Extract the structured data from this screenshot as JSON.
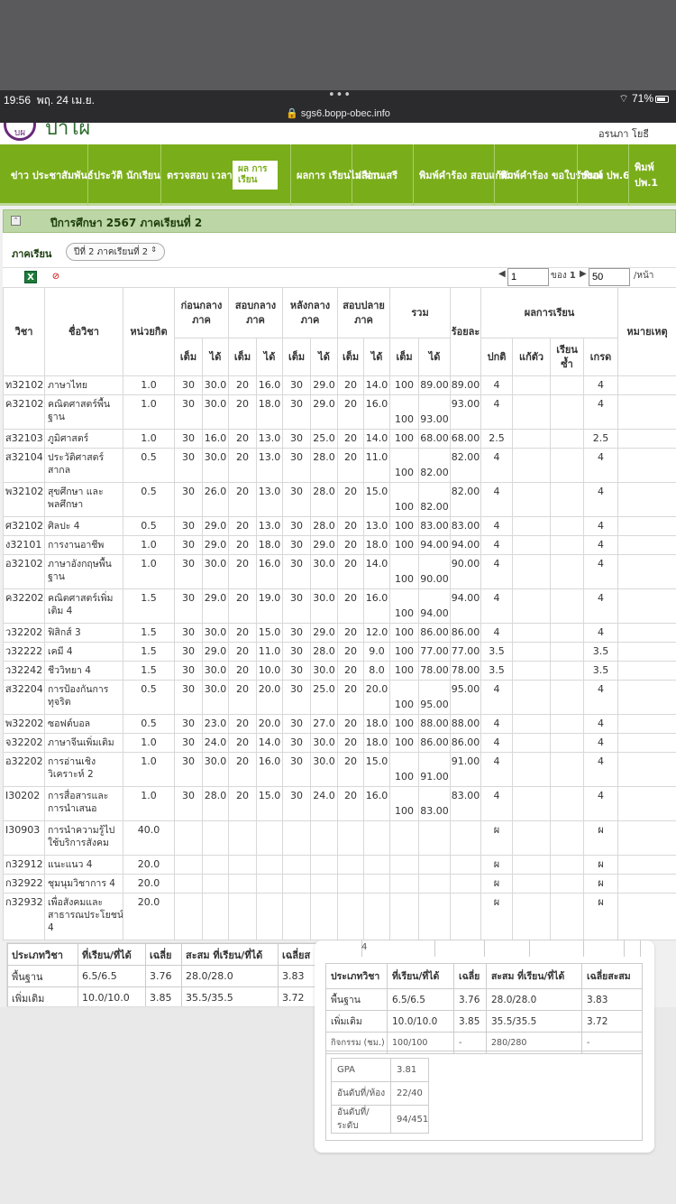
{
  "status_bar": {
    "time": "19:56",
    "date": "พฤ. 24 เม.ย.",
    "url": "sgs6.bopp-obec.info",
    "battery": "71%"
  },
  "header": {
    "app_name": "ป่าไผ่",
    "logo_text": "บผ",
    "user": "อรนภา โยธี"
  },
  "nav": {
    "items": [
      {
        "label": "ข่าว ประชาสัมพันธ์"
      },
      {
        "label": "ประวัติ นักเรียน"
      },
      {
        "label": "ตรวจสอบ เวลาเรียน"
      },
      {
        "label": "ผล การ เรียน"
      },
      {
        "label": "ผลการ เรียนไม่ ผ่าน"
      },
      {
        "label": "เลือก เสรี"
      },
      {
        "label": "พิมพ์คำร้อง สอบแก้ตัว"
      },
      {
        "label": "พิมพ์คำร้อง ขอใบรับรอง"
      },
      {
        "label": "พิมพ์ ปพ.6"
      },
      {
        "label": "พิมพ์ ปพ.1"
      }
    ]
  },
  "term": {
    "title": "ปีการศึกษา 2567 ภาคเรียนที่ 2",
    "label": "ภาคเรียน",
    "selected": "ปีที่ 2 ภาคเรียนที่ 2"
  },
  "pager": {
    "page": "1",
    "of_label": "ของ",
    "total_pages": "1",
    "page_size": "50",
    "per_page": "/หน้า"
  },
  "table": {
    "headers": {
      "code": "วิชา",
      "name": "ชื่อวิชา",
      "credit": "หน่วยกิต",
      "before_mid": "ก่อนกลางภาค",
      "mid": "สอบกลางภาค",
      "after_mid": "หลังกลางภาค",
      "final": "สอบปลายภาค",
      "total": "รวม",
      "percent": "ร้อยละ",
      "result": "ผลการเรียน",
      "note": "หมายเหตุ",
      "full": "เต็ม",
      "got": "ได้",
      "normal": "ปกติ",
      "retake": "แก้ตัว",
      "repeat": "เรียนซ้ำ",
      "grade": "เกรด"
    },
    "rows": [
      {
        "code": "ท32102",
        "name": "ภาษาไทย",
        "credit": "1.0",
        "bf": "30",
        "bg": "30.0",
        "mf": "20",
        "mg": "16.0",
        "af": "30",
        "ag": "29.0",
        "ff": "20",
        "fg": "14.0",
        "tf": "100",
        "tg": "89.00",
        "pct": "89.00",
        "normal": "4",
        "retake": "",
        "repeat": "",
        "grade": "4"
      },
      {
        "code": "ค32102",
        "name": "คณิตศาสตร์พื้นฐาน",
        "credit": "1.0",
        "bf": "30",
        "bg": "30.0",
        "mf": "20",
        "mg": "18.0",
        "af": "30",
        "ag": "29.0",
        "ff": "20",
        "fg": "16.0",
        "tf": "100",
        "tg": "93.00",
        "pct": "93.00",
        "normal": "4",
        "retake": "",
        "repeat": "",
        "grade": "4"
      },
      {
        "code": "ส32103",
        "name": "ภูมิศาสตร์",
        "credit": "1.0",
        "bf": "30",
        "bg": "16.0",
        "mf": "20",
        "mg": "13.0",
        "af": "30",
        "ag": "25.0",
        "ff": "20",
        "fg": "14.0",
        "tf": "100",
        "tg": "68.00",
        "pct": "68.00",
        "normal": "2.5",
        "retake": "",
        "repeat": "",
        "grade": "2.5"
      },
      {
        "code": "ส32104",
        "name": "ประวัติศาสตร์สากล",
        "credit": "0.5",
        "bf": "30",
        "bg": "30.0",
        "mf": "20",
        "mg": "13.0",
        "af": "30",
        "ag": "28.0",
        "ff": "20",
        "fg": "11.0",
        "tf": "100",
        "tg": "82.00",
        "pct": "82.00",
        "normal": "4",
        "retake": "",
        "repeat": "",
        "grade": "4"
      },
      {
        "code": "พ32102",
        "name": "สุขศึกษา และพลศึกษา",
        "credit": "0.5",
        "bf": "30",
        "bg": "26.0",
        "mf": "20",
        "mg": "13.0",
        "af": "30",
        "ag": "28.0",
        "ff": "20",
        "fg": "15.0",
        "tf": "100",
        "tg": "82.00",
        "pct": "82.00",
        "normal": "4",
        "retake": "",
        "repeat": "",
        "grade": "4"
      },
      {
        "code": "ศ32102",
        "name": "ศิลปะ 4",
        "credit": "0.5",
        "bf": "30",
        "bg": "29.0",
        "mf": "20",
        "mg": "13.0",
        "af": "30",
        "ag": "28.0",
        "ff": "20",
        "fg": "13.0",
        "tf": "100",
        "tg": "83.00",
        "pct": "83.00",
        "normal": "4",
        "retake": "",
        "repeat": "",
        "grade": "4"
      },
      {
        "code": "ง32101",
        "name": "การงานอาชีพ",
        "credit": "1.0",
        "bf": "30",
        "bg": "29.0",
        "mf": "20",
        "mg": "18.0",
        "af": "30",
        "ag": "29.0",
        "ff": "20",
        "fg": "18.0",
        "tf": "100",
        "tg": "94.00",
        "pct": "94.00",
        "normal": "4",
        "retake": "",
        "repeat": "",
        "grade": "4"
      },
      {
        "code": "อ32102",
        "name": "ภาษาอังกฤษพื้นฐาน",
        "credit": "1.0",
        "bf": "30",
        "bg": "30.0",
        "mf": "20",
        "mg": "16.0",
        "af": "30",
        "ag": "30.0",
        "ff": "20",
        "fg": "14.0",
        "tf": "100",
        "tg": "90.00",
        "pct": "90.00",
        "normal": "4",
        "retake": "",
        "repeat": "",
        "grade": "4"
      },
      {
        "code": "ค32202",
        "name": "คณิตศาสตร์เพิ่มเติม 4",
        "credit": "1.5",
        "bf": "30",
        "bg": "29.0",
        "mf": "20",
        "mg": "19.0",
        "af": "30",
        "ag": "30.0",
        "ff": "20",
        "fg": "16.0",
        "tf": "100",
        "tg": "94.00",
        "pct": "94.00",
        "normal": "4",
        "retake": "",
        "repeat": "",
        "grade": "4"
      },
      {
        "code": "ว32202",
        "name": "ฟิสิกส์ 3",
        "credit": "1.5",
        "bf": "30",
        "bg": "30.0",
        "mf": "20",
        "mg": "15.0",
        "af": "30",
        "ag": "29.0",
        "ff": "20",
        "fg": "12.0",
        "tf": "100",
        "tg": "86.00",
        "pct": "86.00",
        "normal": "4",
        "retake": "",
        "repeat": "",
        "grade": "4"
      },
      {
        "code": "ว32222",
        "name": "เคมี 4",
        "credit": "1.5",
        "bf": "30",
        "bg": "29.0",
        "mf": "20",
        "mg": "11.0",
        "af": "30",
        "ag": "28.0",
        "ff": "20",
        "fg": "9.0",
        "tf": "100",
        "tg": "77.00",
        "pct": "77.00",
        "normal": "3.5",
        "retake": "",
        "repeat": "",
        "grade": "3.5"
      },
      {
        "code": "ว32242",
        "name": "ชีววิทยา 4",
        "credit": "1.5",
        "bf": "30",
        "bg": "30.0",
        "mf": "20",
        "mg": "10.0",
        "af": "30",
        "ag": "30.0",
        "ff": "20",
        "fg": "8.0",
        "tf": "100",
        "tg": "78.00",
        "pct": "78.00",
        "normal": "3.5",
        "retake": "",
        "repeat": "",
        "grade": "3.5"
      },
      {
        "code": "ส32204",
        "name": "การป้องกันการทุจริต",
        "credit": "0.5",
        "bf": "30",
        "bg": "30.0",
        "mf": "20",
        "mg": "20.0",
        "af": "30",
        "ag": "25.0",
        "ff": "20",
        "fg": "20.0",
        "tf": "100",
        "tg": "95.00",
        "pct": "95.00",
        "normal": "4",
        "retake": "",
        "repeat": "",
        "grade": "4"
      },
      {
        "code": "พ32202",
        "name": "ซอฟต์บอล",
        "credit": "0.5",
        "bf": "30",
        "bg": "23.0",
        "mf": "20",
        "mg": "20.0",
        "af": "30",
        "ag": "27.0",
        "ff": "20",
        "fg": "18.0",
        "tf": "100",
        "tg": "88.00",
        "pct": "88.00",
        "normal": "4",
        "retake": "",
        "repeat": "",
        "grade": "4"
      },
      {
        "code": "จ32202",
        "name": "ภาษาจีนเพิ่มเติม",
        "credit": "1.0",
        "bf": "30",
        "bg": "24.0",
        "mf": "20",
        "mg": "14.0",
        "af": "30",
        "ag": "30.0",
        "ff": "20",
        "fg": "18.0",
        "tf": "100",
        "tg": "86.00",
        "pct": "86.00",
        "normal": "4",
        "retake": "",
        "repeat": "",
        "grade": "4"
      },
      {
        "code": "อ32202",
        "name": "การอ่านเชิงวิเคราะห์ 2",
        "credit": "1.0",
        "bf": "30",
        "bg": "30.0",
        "mf": "20",
        "mg": "16.0",
        "af": "30",
        "ag": "30.0",
        "ff": "20",
        "fg": "15.0",
        "tf": "100",
        "tg": "91.00",
        "pct": "91.00",
        "normal": "4",
        "retake": "",
        "repeat": "",
        "grade": "4"
      },
      {
        "code": "I30202",
        "name": "การสื่อสารและการนำเสนอ",
        "credit": "1.0",
        "bf": "30",
        "bg": "28.0",
        "mf": "20",
        "mg": "15.0",
        "af": "30",
        "ag": "24.0",
        "ff": "20",
        "fg": "16.0",
        "tf": "100",
        "tg": "83.00",
        "pct": "83.00",
        "normal": "4",
        "retake": "",
        "repeat": "",
        "grade": "4"
      },
      {
        "code": "I30903",
        "name": "การนำความรู้ไปใช้บริการสังคม",
        "credit": "40.0",
        "bf": "",
        "bg": "",
        "mf": "",
        "mg": "",
        "af": "",
        "ag": "",
        "ff": "",
        "fg": "",
        "tf": "",
        "tg": "",
        "pct": "",
        "normal": "ผ",
        "retake": "",
        "repeat": "",
        "grade": "ผ"
      },
      {
        "code": "ก32912",
        "name": "แนะแนว 4",
        "credit": "20.0",
        "bf": "",
        "bg": "",
        "mf": "",
        "mg": "",
        "af": "",
        "ag": "",
        "ff": "",
        "fg": "",
        "tf": "",
        "tg": "",
        "pct": "",
        "normal": "ผ",
        "retake": "",
        "repeat": "",
        "grade": "ผ"
      },
      {
        "code": "ก32922",
        "name": "ชุมนุมวิชาการ 4",
        "credit": "20.0",
        "bf": "",
        "bg": "",
        "mf": "",
        "mg": "",
        "af": "",
        "ag": "",
        "ff": "",
        "fg": "",
        "tf": "",
        "tg": "",
        "pct": "",
        "normal": "ผ",
        "retake": "",
        "repeat": "",
        "grade": "ผ"
      },
      {
        "code": "ก32932",
        "name": "เพื่อสังคมและสาธารณประโยชน์ 4",
        "credit": "20.0",
        "bf": "",
        "bg": "",
        "mf": "",
        "mg": "",
        "af": "",
        "ag": "",
        "ff": "",
        "fg": "",
        "tf": "",
        "tg": "",
        "pct": "",
        "normal": "ผ",
        "retake": "",
        "repeat": "",
        "grade": "ผ"
      }
    ]
  },
  "summary_left": {
    "headers": {
      "type": "ประเภทวิชา",
      "credits": "ที่เรียน/ที่ได้",
      "avg": "เฉลี่ย",
      "cum": "สะสม ที่เรียน/ที่ได้",
      "cum_avg": "เฉลี่ยส"
    },
    "rows": [
      {
        "type": "พื้นฐาน",
        "credits": "6.5/6.5",
        "avg": "3.76",
        "cum": "28.0/28.0",
        "cum_avg": "3.83"
      },
      {
        "type": "เพิ่มเติม",
        "credits": "10.0/10.0",
        "avg": "3.85",
        "cum": "35.5/35.5",
        "cum_avg": "3.72"
      }
    ]
  },
  "summary_card": {
    "top_cell": "4",
    "headers": {
      "type": "ประเภทวิชา",
      "credits": "ที่เรียน/ที่ได้",
      "avg": "เฉลี่ย",
      "cum": "สะสม ที่เรียน/ที่ได้",
      "cum_avg": "เฉลี่ยสะสม"
    },
    "rows": [
      {
        "type": "พื้นฐาน",
        "credits": "6.5/6.5",
        "avg": "3.76",
        "cum": "28.0/28.0",
        "cum_avg": "3.83"
      },
      {
        "type": "เพิ่มเติม",
        "credits": "10.0/10.0",
        "avg": "3.85",
        "cum": "35.5/35.5",
        "cum_avg": "3.72"
      },
      {
        "type": "กิจกรรม (ชม.)",
        "credits": "100/100",
        "avg": "-",
        "cum": "280/280",
        "cum_avg": "-"
      }
    ],
    "gpa_label": "GPA",
    "gpa": "3.81",
    "class_rank_label": "อันดับที่/ห้อง",
    "class_rank": "22/40",
    "level_rank_label": "อันดับที่/ระดับ",
    "level_rank": "94/451"
  }
}
